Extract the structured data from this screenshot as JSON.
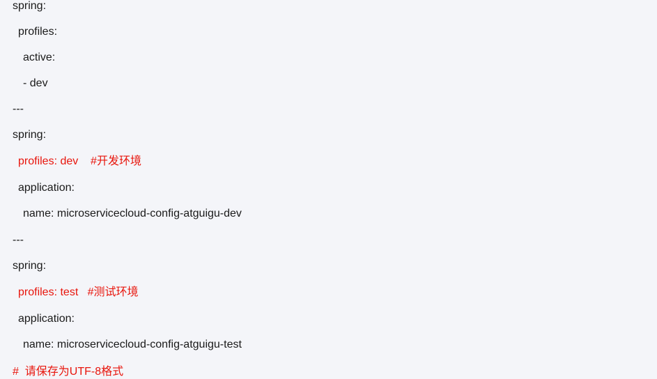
{
  "lines": [
    {
      "text": "spring:",
      "red": false
    },
    {
      "text": "profiles:",
      "red": false
    },
    {
      "text": "active:",
      "red": false
    },
    {
      "text": "- dev",
      "red": false
    },
    {
      "text": "---",
      "red": false
    },
    {
      "text": "spring:",
      "red": false
    },
    {
      "text": "profiles: dev    #开发环境",
      "red": true
    },
    {
      "text": "application:",
      "red": false
    },
    {
      "text": "name: microservicecloud-config-atguigu-dev",
      "red": false
    },
    {
      "text": "---",
      "red": false
    },
    {
      "text": "spring:",
      "red": false
    },
    {
      "text": "profiles: test   #测试环境",
      "red": true
    },
    {
      "text": "application:",
      "red": false
    },
    {
      "text": "name: microservicecloud-config-atguigu-test",
      "red": false
    },
    {
      "text": "#  请保存为UTF-8格式",
      "red": true
    }
  ],
  "colors": {
    "background": "#f4f5f9",
    "text": "#1a1a1a",
    "comment_red": "#e8150c"
  }
}
